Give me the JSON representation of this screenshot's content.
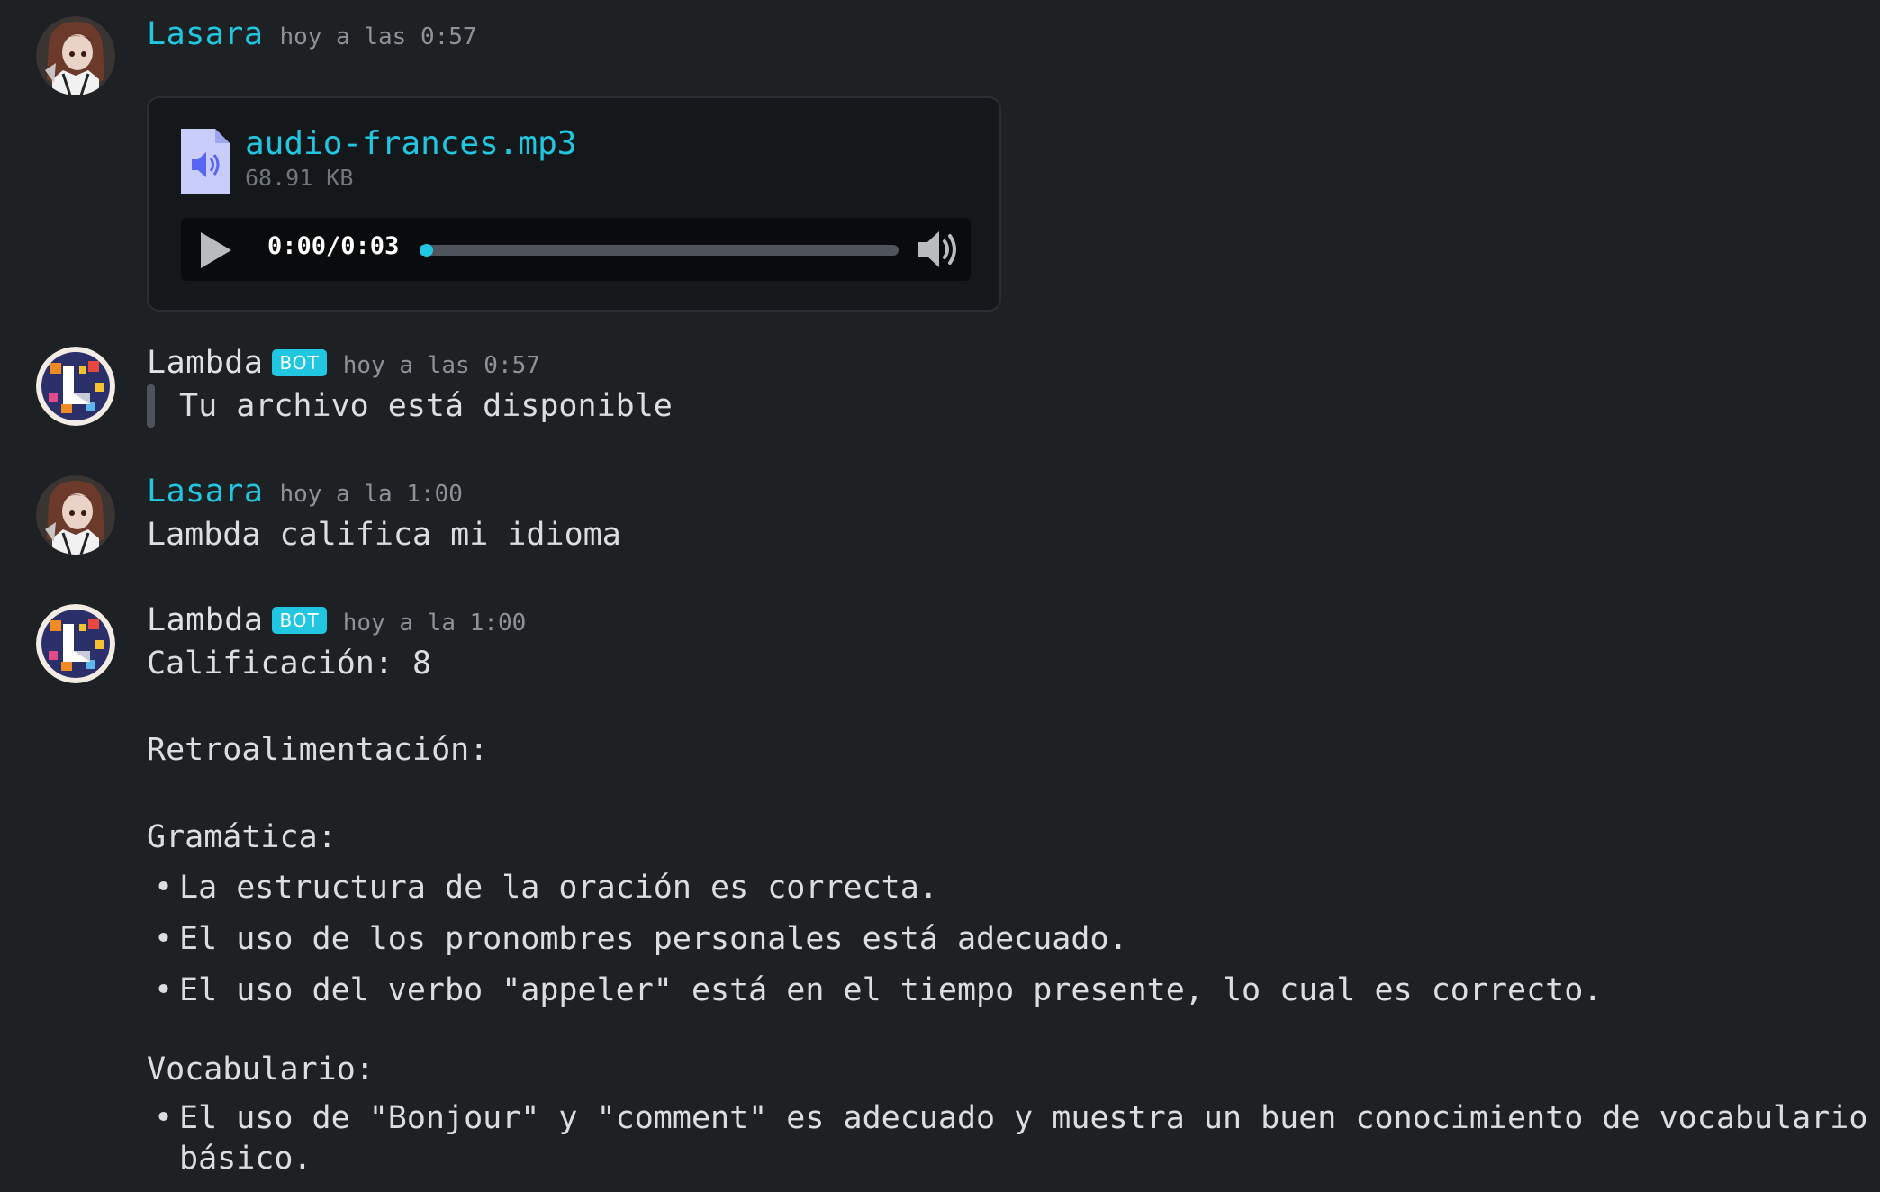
{
  "messages": [
    {
      "author": "Lasara",
      "timestamp": "hoy a las 0:57",
      "attachment": {
        "file_name": "audio-frances.mp3",
        "file_size": "68.91 KB",
        "player": {
          "current_time": "0:00",
          "separator": "/",
          "duration": "0:03",
          "progress": 0.0
        }
      }
    },
    {
      "author": "Lambda",
      "badge": "BOT",
      "timestamp": "hoy a las 0:57",
      "quote": "Tu archivo está disponible"
    },
    {
      "author": "Lasara",
      "timestamp": "hoy a la 1:00",
      "text": "Lambda califica mi idioma"
    },
    {
      "author": "Lambda",
      "badge": "BOT",
      "timestamp": "hoy a la 1:00",
      "rating_line": "Calificación: 8",
      "feedback_heading": "Retroalimentación:",
      "grammar_heading": "Gramática:",
      "grammar_points": [
        "La estructura de la oración es correcta.",
        "El uso de los pronombres personales está adecuado.",
        "El uso del verbo \"appeler\" está en el tiempo presente, lo cual es correcto."
      ],
      "vocabulary_heading": "Vocabulario:",
      "vocabulary_points": [
        "El uso de \"Bonjour\" y \"comment\" es adecuado y muestra un buen conocimiento de vocabulario básico."
      ]
    }
  ],
  "bullet_char": "•",
  "colors": {
    "background": "#1e2124",
    "accent": "#21c7e0",
    "text": "#dcddde",
    "muted": "#8e9297",
    "attachment_bg": "#15181b",
    "file_icon": "#c9cdfb"
  },
  "icons": {
    "file": "audio-file-icon",
    "play": "play-icon",
    "volume": "volume-icon"
  }
}
